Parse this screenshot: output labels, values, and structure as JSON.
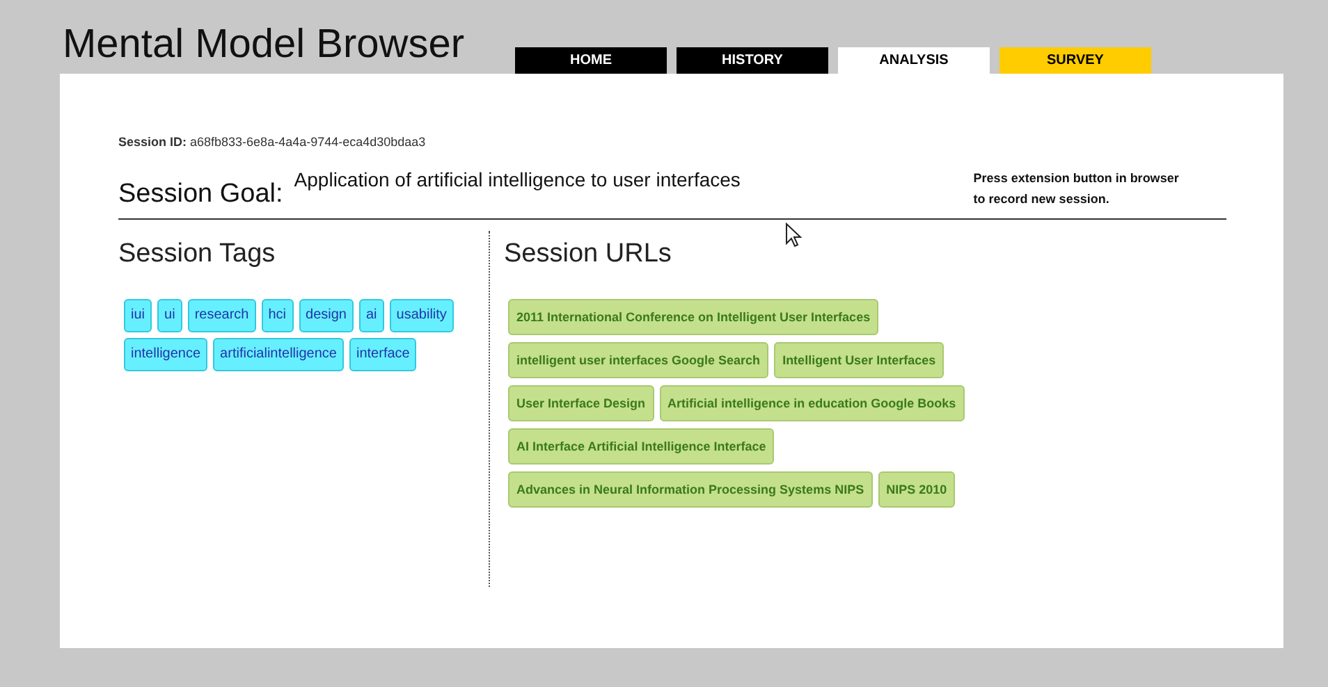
{
  "title": "Mental Model Browser",
  "tabs": [
    {
      "label": "HOME",
      "selected": false,
      "kind": "normal"
    },
    {
      "label": "HISTORY",
      "selected": false,
      "kind": "normal"
    },
    {
      "label": "ANALYSIS",
      "selected": true,
      "kind": "normal"
    },
    {
      "label": "SURVEY",
      "selected": false,
      "kind": "highlight"
    }
  ],
  "session": {
    "id_label": "Session ID:",
    "id": "a68fb833-6e8a-4a4a-9744-eca4d30bdaa3",
    "goal_label": "Session Goal:",
    "goal": "Application of artificial intelligence to user interfaces",
    "hint": "Press extension button in browser to record new session."
  },
  "tags_heading": "Session Tags",
  "tags": [
    "iui",
    "ui",
    "research",
    "hci",
    "design",
    "ai",
    "usability",
    "intelligence",
    "artificialintelligence",
    "interface"
  ],
  "urls_heading": "Session URLs",
  "urls": [
    "2011 International Conference on Intelligent User Interfaces",
    "intelligent user interfaces Google Search",
    "Intelligent User Interfaces",
    "User Interface Design",
    "Artificial intelligence in education Google Books",
    "AI Interface Artificial Intelligence Interface",
    "Advances in Neural Information Processing Systems NIPS",
    "NIPS 2010"
  ]
}
